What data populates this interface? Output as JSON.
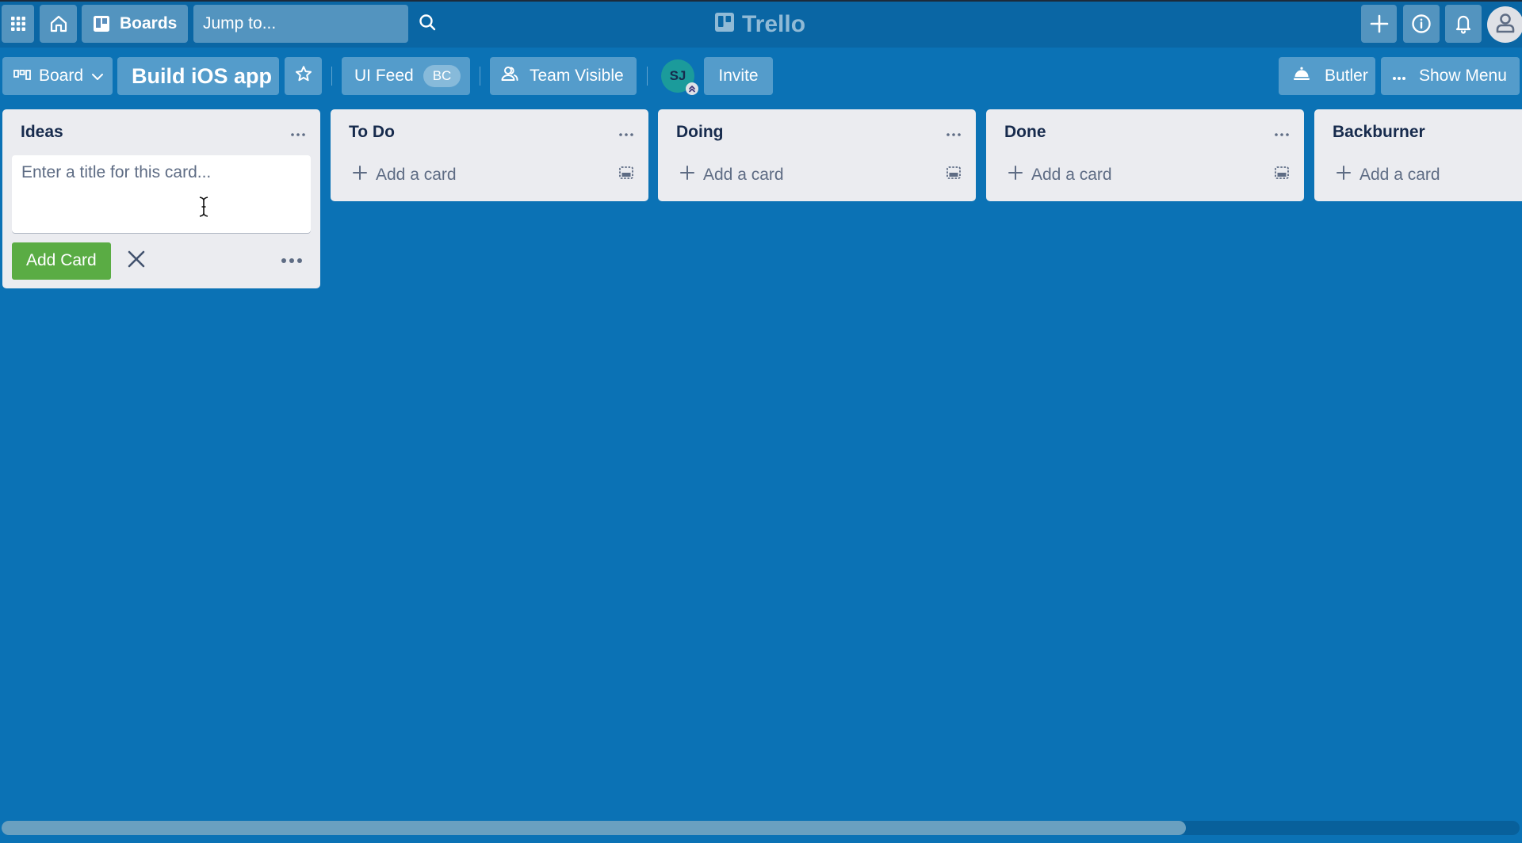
{
  "header": {
    "apps_icon": "grid-icon",
    "home_icon": "home-icon",
    "boards_label": "Boards",
    "search_placeholder": "Jump to...",
    "logo_text": "Trello",
    "create_icon": "plus-icon",
    "info_icon": "info-icon",
    "notifications_icon": "bell-icon",
    "account_icon": "user-icon"
  },
  "board_header": {
    "view_label": "Board",
    "board_title": "Build iOS app",
    "star_icon": "star-icon",
    "team_label": "UI Feed",
    "team_badge": "BC",
    "visibility_label": "Team Visible",
    "member_initials": "SJ",
    "invite_label": "Invite",
    "butler_label": "Butler",
    "show_menu_label": "Show Menu"
  },
  "lists": [
    {
      "title": "Ideas",
      "composer": {
        "placeholder": "Enter a title for this card...",
        "value": "",
        "submit_label": "Add Card"
      }
    },
    {
      "title": "To Do",
      "add_label": "Add a card"
    },
    {
      "title": "Doing",
      "add_label": "Add a card"
    },
    {
      "title": "Done",
      "add_label": "Add a card"
    },
    {
      "title": "Backburner",
      "add_label": "Add a card"
    }
  ],
  "scrollbar": {
    "horizontal_position_fraction": 0.78
  },
  "colors": {
    "board_background": "#0b72b5",
    "list_background": "#ebecf0",
    "add_card_green": "#5aac44",
    "member_avatar": "#1b9b9b"
  }
}
